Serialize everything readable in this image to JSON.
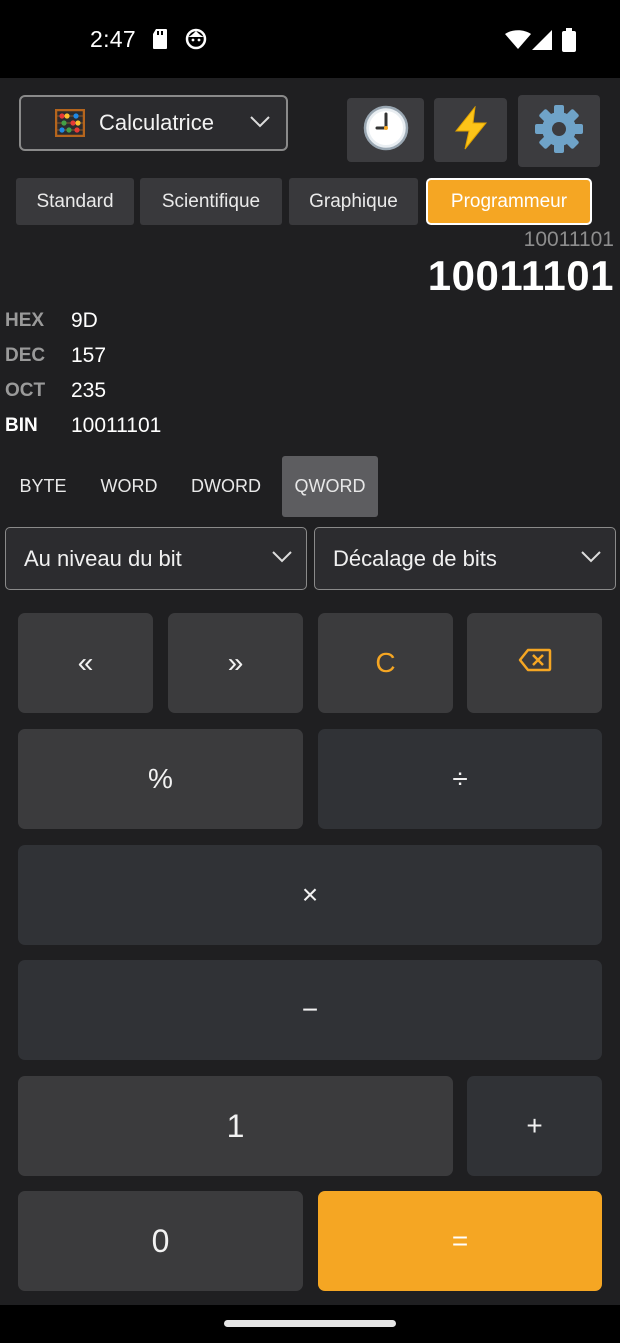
{
  "status_bar": {
    "time": "2:47",
    "icons": [
      "sd-card-icon",
      "face-icon",
      "wifi-icon",
      "signal-icon",
      "battery-icon"
    ]
  },
  "app_selector": {
    "label": "Calculatrice",
    "icon": "abacus-icon"
  },
  "toolbar": {
    "history_icon": "clock-icon",
    "converter_icon": "lightning-icon",
    "settings_icon": "gear-icon"
  },
  "modes": {
    "items": [
      {
        "label": "Standard",
        "active": false
      },
      {
        "label": "Scientifique",
        "active": false
      },
      {
        "label": "Graphique",
        "active": false
      },
      {
        "label": "Programmeur",
        "active": true
      }
    ]
  },
  "display": {
    "expression": "10011101",
    "result": "10011101"
  },
  "bases": [
    {
      "key": "HEX",
      "value": "9D",
      "selected": false
    },
    {
      "key": "DEC",
      "value": "157",
      "selected": false
    },
    {
      "key": "OCT",
      "value": "235",
      "selected": false
    },
    {
      "key": "BIN",
      "value": "10011101",
      "selected": true
    }
  ],
  "word_sizes": [
    {
      "label": "BYTE",
      "active": false
    },
    {
      "label": "WORD",
      "active": false
    },
    {
      "label": "DWORD",
      "active": false
    },
    {
      "label": "QWORD",
      "active": true
    }
  ],
  "dropdowns": {
    "bitwise": "Au niveau du bit",
    "bitshift": "Décalage de bits"
  },
  "keys": {
    "shift_left": "«",
    "shift_right": "»",
    "clear": "C",
    "backspace_icon": "backspace-icon",
    "modulo": "%",
    "divide": "÷",
    "multiply": "×",
    "minus": "−",
    "one": "1",
    "plus": "+",
    "zero": "0",
    "equals": "="
  },
  "colors": {
    "accent": "#f5a623",
    "background": "#1f1f21",
    "key_light": "#3b3b3d",
    "key_dark": "#303236"
  }
}
